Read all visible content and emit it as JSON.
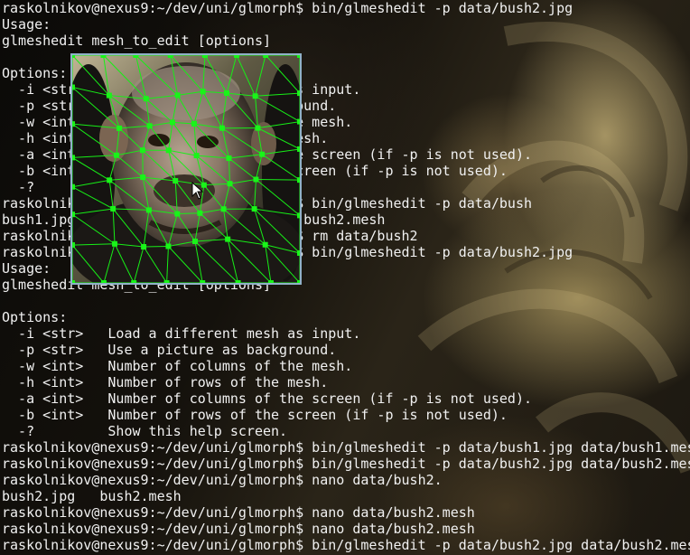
{
  "terminal": {
    "lines": [
      "raskolnikov@nexus9:~/dev/uni/glmorph$ bin/glmeshedit -p data/bush2.jpg",
      "Usage:",
      "glmeshedit mesh_to_edit [options]",
      "",
      "Options:",
      "  -i <str>   Load a different mesh as input.",
      "  -p <str>   Use a picture as background.",
      "  -w <int>   Number of columns of the mesh.",
      "  -h <int>   Number of rows of the mesh.",
      "  -a <int>   Number of columns of the screen (if -p is not used).",
      "  -b <int>   Number of rows of the screen (if -p is not used).",
      "  -?         Show this help screen.",
      "raskolnikov@nexus9:~/dev/uni/glmorph$ bin/glmeshedit -p data/bush",
      "bush1.jpg   bush1.mesh   bush2.jpg   bush2.mesh",
      "raskolnikov@nexus9:~/dev/uni/glmorph$ rm data/bush2",
      "raskolnikov@nexus9:~/dev/uni/glmorph$ bin/glmeshedit -p data/bush2.jpg",
      "Usage:",
      "glmeshedit mesh_to_edit [options]",
      "",
      "Options:",
      "  -i <str>   Load a different mesh as input.",
      "  -p <str>   Use a picture as background.",
      "  -w <int>   Number of columns of the mesh.",
      "  -h <int>   Number of rows of the mesh.",
      "  -a <int>   Number of columns of the screen (if -p is not used).",
      "  -b <int>   Number of rows of the screen (if -p is not used).",
      "  -?         Show this help screen.",
      "raskolnikov@nexus9:~/dev/uni/glmorph$ bin/glmeshedit -p data/bush1.jpg data/bush1.mesh",
      "raskolnikov@nexus9:~/dev/uni/glmorph$ bin/glmeshedit -p data/bush2.jpg data/bush2.mesh",
      "raskolnikov@nexus9:~/dev/uni/glmorph$ nano data/bush2.",
      "bush2.jpg   bush2.mesh",
      "raskolnikov@nexus9:~/dev/uni/glmorph$ nano data/bush2.mesh",
      "raskolnikov@nexus9:~/dev/uni/glmorph$ nano data/bush2.mesh",
      "raskolnikov@nexus9:~/dev/uni/glmorph$ bin/glmeshedit -p data/bush2.jpg data/bush2.mesh"
    ],
    "text_color": "#f1f1f1"
  },
  "mesh_editor": {
    "window_border_color": "#8fb1c7",
    "mesh_color": "#17ee17",
    "node_color": "#19f419",
    "background_image": "chimpanzee-face-photo",
    "cursor_icon": "arrow-pointer-icon"
  },
  "desktop": {
    "wallpaper": "yellow-rose-photo"
  }
}
